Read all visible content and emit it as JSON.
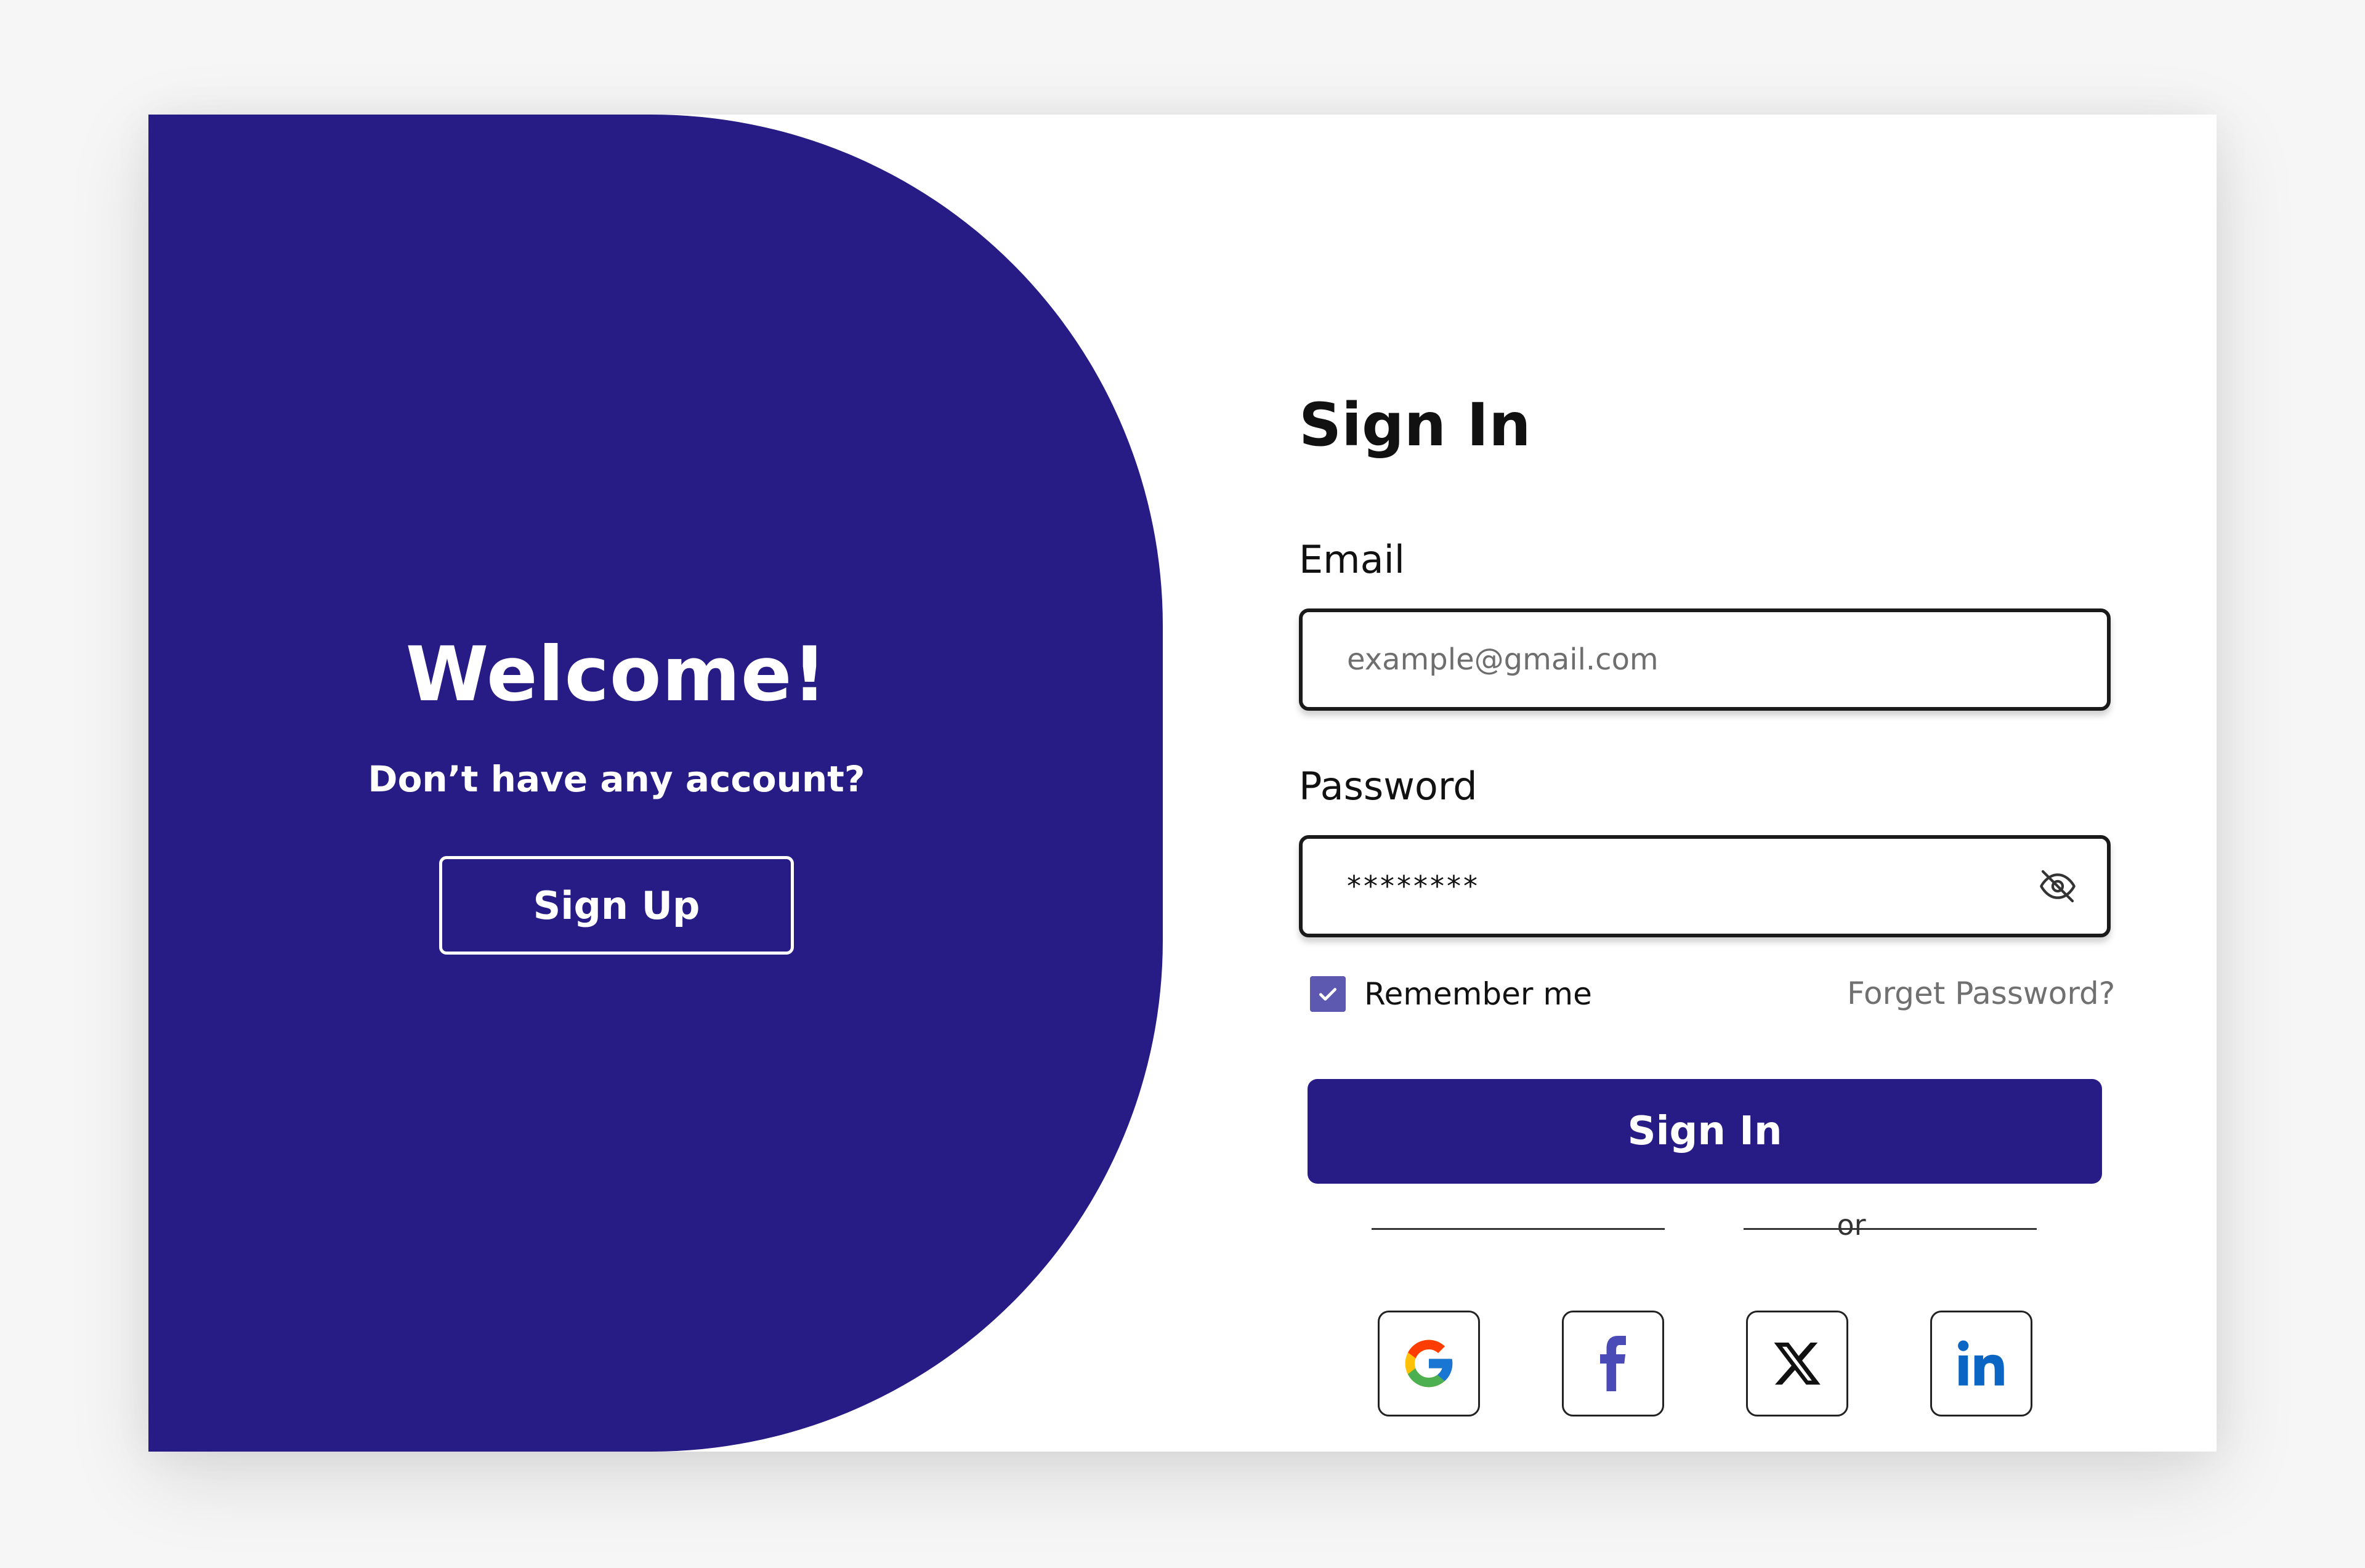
{
  "welcome": {
    "title": "Welcome!",
    "subtitle": "Don’t have any account?",
    "signup_label": "Sign Up"
  },
  "form": {
    "title": "Sign In",
    "email_label": "Email",
    "email_placeholder": "example@gmail.com",
    "password_label": "Password",
    "password_value": "********",
    "password_visibility_icon": "eye-off-icon",
    "remember_label": "Remember me",
    "remember_checked": true,
    "forgot_label": "Forget Password?",
    "signin_label": "Sign In",
    "divider_text": "or"
  },
  "social": [
    {
      "name": "Google",
      "icon": "google-icon"
    },
    {
      "name": "Facebook",
      "icon": "facebook-icon"
    },
    {
      "name": "X",
      "icon": "x-icon"
    },
    {
      "name": "LinkedIn",
      "icon": "linkedin-icon"
    }
  ],
  "colors": {
    "primary": "#271c86",
    "checkbox": "#5d59b0",
    "background": "#f6f6f6",
    "facebook": "#4b4bb8",
    "linkedin": "#0a66c2"
  }
}
